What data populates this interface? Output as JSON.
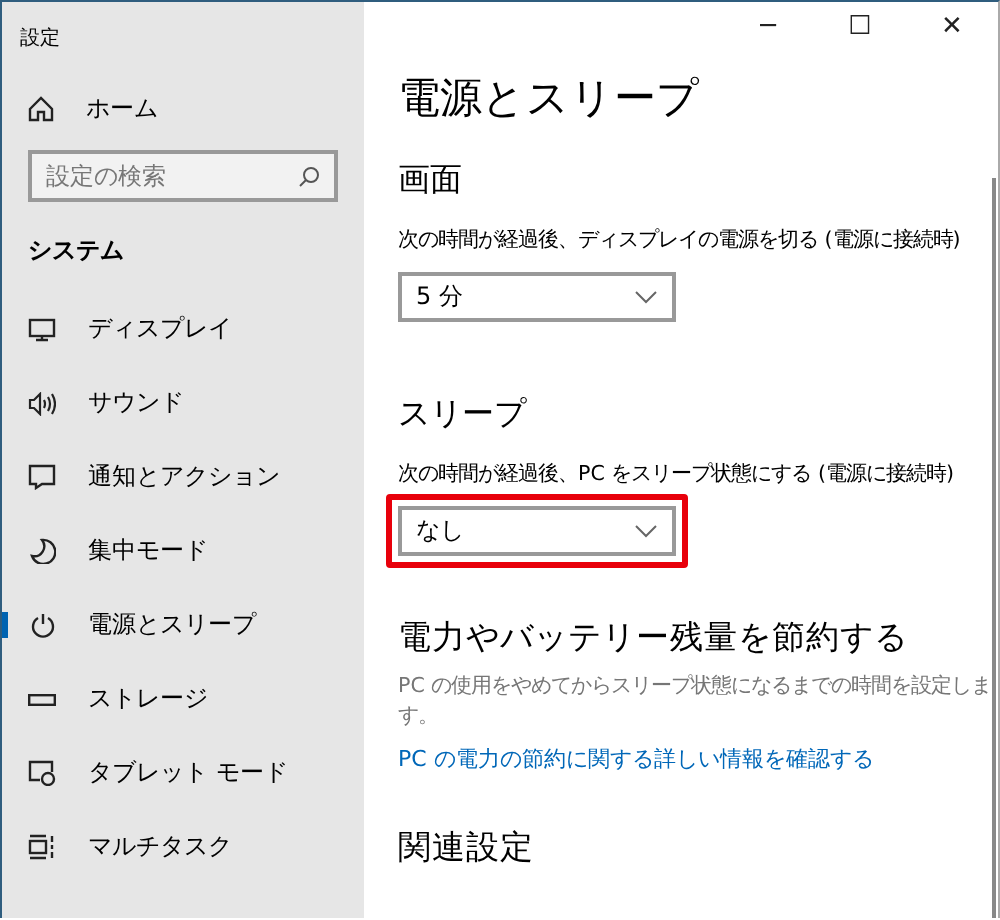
{
  "window": {
    "title": "設定",
    "controls": [
      "─",
      "☐",
      "✕"
    ]
  },
  "sidebar": {
    "home": "ホーム",
    "search": {
      "placeholder": "設定の検索"
    },
    "section": "システム",
    "items": [
      {
        "label": "ディスプレイ",
        "selected": false
      },
      {
        "label": "サウンド",
        "selected": false
      },
      {
        "label": "通知とアクション",
        "selected": false
      },
      {
        "label": "集中モード",
        "selected": false
      },
      {
        "label": "電源とスリープ",
        "selected": true
      },
      {
        "label": "ストレージ",
        "selected": false
      },
      {
        "label": "タブレット モード",
        "selected": false
      },
      {
        "label": "マルチタスク",
        "selected": false
      }
    ]
  },
  "page": {
    "title": "電源とスリープ",
    "sections": [
      {
        "heading": "画面",
        "label": "次の時間が経過後、ディスプレイの電源を切る (電源に接続時)",
        "value": "5 分",
        "highlighted": false
      },
      {
        "heading": "スリープ",
        "label": "次の時間が経過後、PC をスリープ状態にする (電源に接続時)",
        "value": "なし",
        "highlighted": true
      }
    ],
    "saving": {
      "heading": "電力やバッテリー残量を節約する",
      "description": "PC の使用をやめてからスリープ状態になるまでの時間を設定します。",
      "link": "PC の電力の節約に関する詳しい情報を確認する"
    },
    "related": {
      "heading": "関連設定"
    }
  }
}
